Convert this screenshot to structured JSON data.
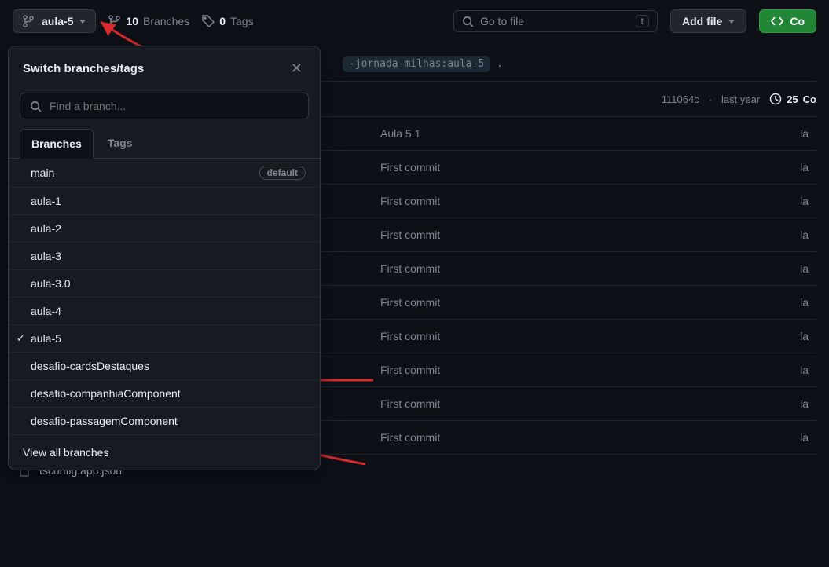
{
  "header": {
    "branch_button": "aula-5",
    "branches_count": "10",
    "branches_label": "Branches",
    "tags_count": "0",
    "tags_label": "Tags",
    "search_placeholder": "Go to file",
    "search_key": "t",
    "add_file": "Add file",
    "code_btn": "Co"
  },
  "dropdown": {
    "title": "Switch branches/tags",
    "find_placeholder": "Find a branch...",
    "tabs": {
      "branches": "Branches",
      "tags": "Tags"
    },
    "default_label": "default",
    "view_all": "View all branches",
    "branches": [
      {
        "name": "main",
        "default": true
      },
      {
        "name": "aula-1"
      },
      {
        "name": "aula-2"
      },
      {
        "name": "aula-3"
      },
      {
        "name": "aula-3.0"
      },
      {
        "name": "aula-4"
      },
      {
        "name": "aula-5",
        "checked": true
      },
      {
        "name": "desafio-cardsDestaques"
      },
      {
        "name": "desafio-companhiaComponent"
      },
      {
        "name": "desafio-passagemComponent"
      }
    ]
  },
  "repo": {
    "path_chip": "-jornada-milhas:aula-5",
    "path_dot": ".",
    "commit_hash": "111064c",
    "commit_sep": "·",
    "commit_age": "last year",
    "commits_count": "25",
    "commits_suffix": "Co",
    "file_at_bottom": "tsconfig.app.json",
    "files": [
      {
        "msg": "Aula 5.1",
        "ago": "la"
      },
      {
        "msg": "First commit",
        "ago": "la"
      },
      {
        "msg": "First commit",
        "ago": "la"
      },
      {
        "msg": "First commit",
        "ago": "la"
      },
      {
        "msg": "First commit",
        "ago": "la"
      },
      {
        "msg": "First commit",
        "ago": "la"
      },
      {
        "msg": "First commit",
        "ago": "la"
      },
      {
        "msg": "First commit",
        "ago": "la"
      },
      {
        "msg": "First commit",
        "ago": "la"
      },
      {
        "msg": "First commit",
        "ago": "la"
      }
    ]
  }
}
